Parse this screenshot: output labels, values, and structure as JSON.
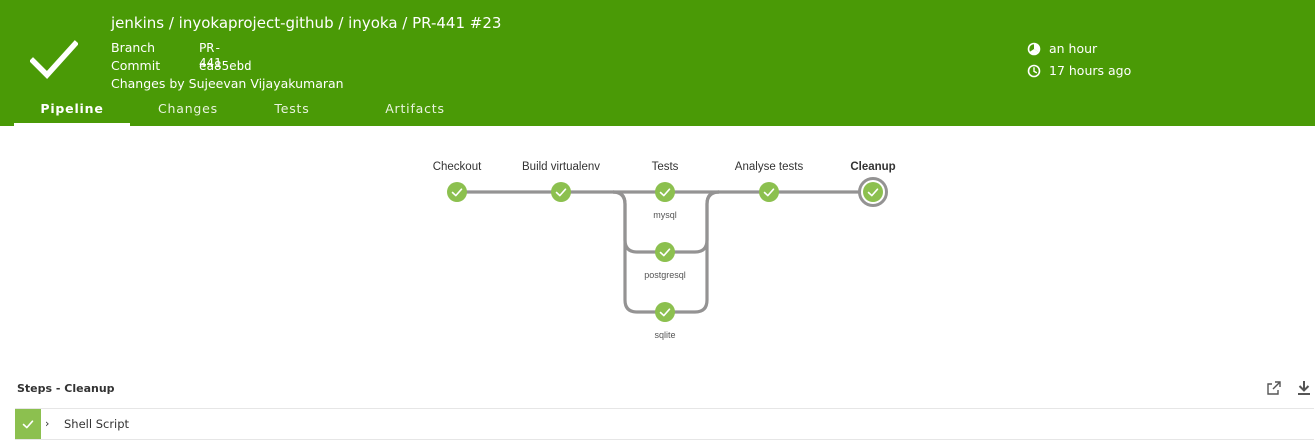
{
  "header": {
    "title": "jenkins / inyokaproject-github / inyoka / PR-441  #23",
    "branch_label": "Branch",
    "branch_value": "PR-441",
    "commit_label": "Commit",
    "commit_value": "ea85ebd",
    "changes_text": "Changes by Sujeevan Vijayakumaran",
    "duration": "an hour",
    "started": "17 hours ago",
    "bg_color": "#4a9a06"
  },
  "tabs": [
    {
      "label": "Pipeline",
      "active": true
    },
    {
      "label": "Changes",
      "active": false
    },
    {
      "label": "Tests",
      "active": false
    },
    {
      "label": "Artifacts",
      "active": false
    }
  ],
  "pipeline": {
    "stages": [
      {
        "label": "Checkout",
        "status": "success"
      },
      {
        "label": "Build virtualenv",
        "status": "success"
      },
      {
        "label": "Tests",
        "status": "success",
        "branches": [
          "mysql",
          "postgresql",
          "sqlite"
        ]
      },
      {
        "label": "Analyse tests",
        "status": "success"
      },
      {
        "label": "Cleanup",
        "status": "success",
        "selected": true
      }
    ],
    "success_color": "#8cc04f"
  },
  "steps": {
    "title": "Steps - Cleanup",
    "items": [
      {
        "label": "Shell Script",
        "status": "success"
      }
    ]
  }
}
